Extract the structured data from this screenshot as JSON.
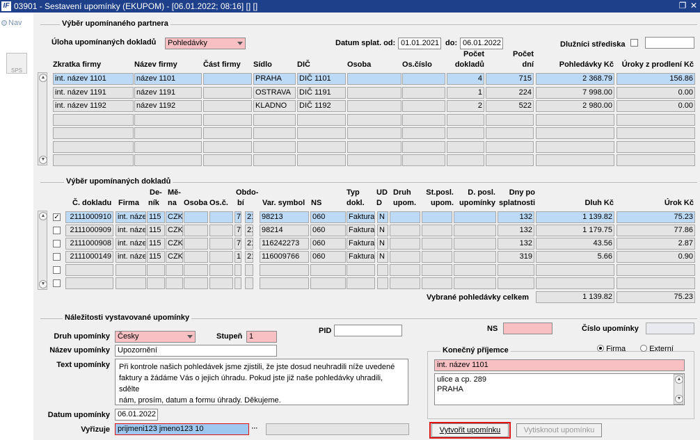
{
  "window": {
    "title": "03901 - Sestavení upomínky (EKUPOM) - [06.01.2022; 08:16] [] []",
    "logo": "IF"
  },
  "leftbar": {
    "nav_label": "Nav",
    "sps_label": "SPS"
  },
  "partner": {
    "section_title": "Výběr upomínaného partnera",
    "uloha_label": "Úloha upomínaných dokladů",
    "uloha_value": "Pohledávky",
    "datum_od_label": "Datum splat. od:",
    "datum_od_value": "01.01.2021",
    "datum_do_label": "do:",
    "datum_do_value": "06.01.2022",
    "dluznici_label": "Dlužníci střediska",
    "cols": [
      "Zkratka firmy",
      "Název firmy",
      "Část firmy",
      "Sídlo",
      "DIČ",
      "Osoba",
      "Os.číslo",
      "Počet",
      "dokladů",
      "Počet",
      "dní",
      "Pohledávky Kč",
      "Úroky z prodlení Kč"
    ],
    "rows": [
      {
        "zkratka": "int. název 1101",
        "nazev": "název 1101",
        "cast": "",
        "sidlo": "PRAHA",
        "dic": "DIČ 1101",
        "osoba": "",
        "oscislo": "",
        "pocet": "4",
        "dni": "715",
        "pohl": "2 368.79",
        "uroky": "156.86"
      },
      {
        "zkratka": "int. název 1191",
        "nazev": "název 1191",
        "cast": "",
        "sidlo": "OSTRAVA",
        "dic": "DIČ 1191",
        "osoba": "",
        "oscislo": "",
        "pocet": "1",
        "dni": "224",
        "pohl": "7 998.00",
        "uroky": "0.00"
      },
      {
        "zkratka": "int. název 1192",
        "nazev": "název 1192",
        "cast": "",
        "sidlo": "KLADNO",
        "dic": "DIČ 1192",
        "osoba": "",
        "oscislo": "",
        "pocet": "2",
        "dni": "522",
        "pohl": "2 980.00",
        "uroky": "0.00"
      }
    ]
  },
  "doklady": {
    "section_title": "Výběr upomínaných dokladů",
    "cols": {
      "c_doklad": "Č. dokladu",
      "firma": "Firma",
      "denik1": "De-",
      "denik2": "ník",
      "mena1": "Mě-",
      "mena2": "na",
      "osoba": "Osoba",
      "osc": "Os.č.",
      "obdobi1": "Obdo-",
      "obdobi2": "bí",
      "varsym": "Var. symbol",
      "ns": "NS",
      "typ1": "Typ",
      "typ2": "dokl.",
      "ud1": "UD",
      "ud2": "D",
      "druh1": "Druh",
      "druh2": "upom.",
      "stposl1": "St.posl.",
      "stposl2": "upom.",
      "dposl1": "D. posl.",
      "dposl2": "upomínky",
      "dny1": "Dny po",
      "dny2": "splatnosti",
      "dluh": "Dluh Kč",
      "urok": "Úrok Kč"
    },
    "rows": [
      {
        "checked": "✓",
        "doklad": "2111000910",
        "firma": "int. náze",
        "denik": "115",
        "mena": "CZK",
        "osoba": "",
        "osc": "",
        "ob1": "7",
        "ob2": "21",
        "varsym": "98213",
        "ns": "060",
        "typ": "Faktura",
        "ud": "N",
        "druh": "",
        "stposl": "",
        "dposl": "",
        "dny": "132",
        "dluh": "1 139.82",
        "urok": "75.23"
      },
      {
        "checked": "",
        "doklad": "2111000909",
        "firma": "int. náze",
        "denik": "115",
        "mena": "CZK",
        "osoba": "",
        "osc": "",
        "ob1": "7",
        "ob2": "21",
        "varsym": "98214",
        "ns": "060",
        "typ": "Faktura",
        "ud": "N",
        "druh": "",
        "stposl": "",
        "dposl": "",
        "dny": "132",
        "dluh": "1 179.75",
        "urok": "77.86"
      },
      {
        "checked": "",
        "doklad": "2111000908",
        "firma": "int. náze",
        "denik": "115",
        "mena": "CZK",
        "osoba": "",
        "osc": "",
        "ob1": "7",
        "ob2": "21",
        "varsym": "116242273",
        "ns": "060",
        "typ": "Faktura",
        "ud": "N",
        "druh": "",
        "stposl": "",
        "dposl": "",
        "dny": "132",
        "dluh": "43.56",
        "urok": "2.87"
      },
      {
        "checked": "",
        "doklad": "2111000149",
        "firma": "int. náze",
        "denik": "115",
        "mena": "CZK",
        "osoba": "",
        "osc": "",
        "ob1": "1",
        "ob2": "21",
        "varsym": "116009766",
        "ns": "060",
        "typ": "Faktura",
        "ud": "N",
        "druh": "",
        "stposl": "",
        "dposl": "",
        "dny": "319",
        "dluh": "5.66",
        "urok": "0.90"
      }
    ],
    "total_label": "Vybrané pohledávky celkem",
    "total_dluh": "1 139.82",
    "total_urok": "75.23"
  },
  "nalez": {
    "section_title": "Náležitosti vystavované upomínky",
    "druh_label": "Druh upomínky",
    "druh_value": "Česky",
    "stupen_label": "Stupeň",
    "stupen_value": "1",
    "pid_label": "PID",
    "pid_value": "",
    "ns_label": "NS",
    "ns_value": "",
    "cislo_label": "Číslo upomínky",
    "cislo_value": "",
    "nazev_label": "Název upomínky",
    "nazev_value": "Upozornění",
    "text_label": "Text upomínky",
    "text_lines": [
      "Při kontrole našich pohledávek jsme zjistili, že jste dosud neuhradili níže uvedené",
      "faktury a žádáme Vás o jejich úhradu. Pokud jste již naše pohledávky uhradili, sdělte",
      "nám, prosím, datum a formu úhrady. Děkujeme."
    ],
    "datum_label": "Datum upomínky",
    "datum_value": "06.01.2022",
    "vyrizuje_label": "Vyřizuje",
    "vyrizuje_value": "prijmeni123 jmeno123 10",
    "ellipsis": "···"
  },
  "prijemce": {
    "title": "Konečný příjemce",
    "firma_label": "Firma",
    "externi_label": "Externí",
    "name": "int. název 1101",
    "addr1": "ulice a cp. 289",
    "addr2": "PRAHA"
  },
  "buttons": {
    "vytvorit": "Vytvořit upomínku",
    "vytisknout": "Vytisknout upomínku"
  },
  "colors": {
    "title_bg": "#1e3f8a",
    "selected_row": "#bcd9f6",
    "pink_field": "#f9c0c4",
    "highlight_border": "#e01010"
  }
}
